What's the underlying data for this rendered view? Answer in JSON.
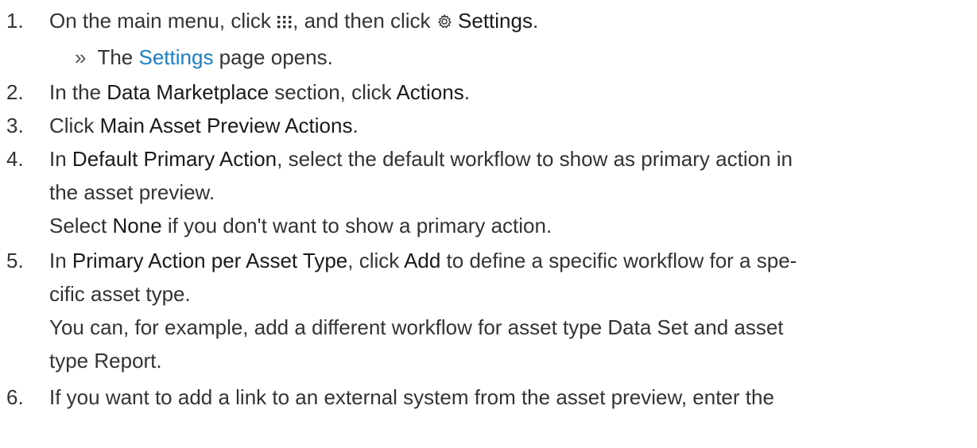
{
  "steps": [
    {
      "number": "1.",
      "parts": {
        "a": "On the main menu, click ",
        "b": ", and then click ",
        "c": "Settings",
        "d": "."
      },
      "icons": {
        "menu": "grid-menu-icon",
        "settings": "gear-icon"
      },
      "result": {
        "marker": "»",
        "pre": "The ",
        "link": "Settings",
        "post": " page opens."
      }
    },
    {
      "number": "2.",
      "parts": {
        "a": "In the ",
        "b": "Data Marketplace",
        "c": " section, click ",
        "d": "Actions",
        "e": "."
      }
    },
    {
      "number": "3.",
      "parts": {
        "a": "Click ",
        "b": "Main Asset Preview Actions",
        "c": "."
      }
    },
    {
      "number": "4.",
      "parts": {
        "a": "In ",
        "b": "Default Primary Action",
        "c": ", select the default workflow to show as primary action in"
      },
      "cont": "the asset preview.",
      "note": {
        "a": "Select ",
        "b": "None",
        "c": " if you don't want to show a primary action."
      }
    },
    {
      "number": "5.",
      "parts": {
        "a": "In ",
        "b": "Primary Action per Asset Type",
        "c": ", click ",
        "d": "Add",
        "e": " to define a specific workflow for a spe-"
      },
      "cont": "cific asset type.",
      "note1": "You can, for example, add a different workflow for asset type Data Set and asset",
      "note2": "type Report."
    },
    {
      "number": "6.",
      "parts": {
        "a": "If you want to add a link to an external system from the asset preview, enter the"
      }
    }
  ],
  "colors": {
    "text": "#333333",
    "emphasis": "#1a1a1a",
    "link": "#1b7fc6"
  }
}
